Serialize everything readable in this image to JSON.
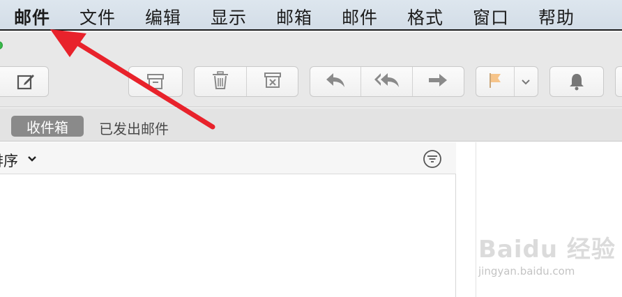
{
  "menubar": {
    "items": [
      {
        "label": "邮件",
        "active": true
      },
      {
        "label": "文件"
      },
      {
        "label": "编辑"
      },
      {
        "label": "显示"
      },
      {
        "label": "邮箱"
      },
      {
        "label": "邮件"
      },
      {
        "label": "格式"
      },
      {
        "label": "窗口"
      },
      {
        "label": "帮助"
      }
    ]
  },
  "toolbar": {
    "buttons": [
      {
        "icon": "compose-icon"
      },
      {
        "icon": "archive-icon"
      },
      {
        "icon": "trash-icon"
      },
      {
        "icon": "junk-icon"
      },
      {
        "icon": "reply-icon"
      },
      {
        "icon": "reply-all-icon"
      },
      {
        "icon": "forward-icon"
      },
      {
        "icon": "flag-icon",
        "color": "#f6c48a"
      },
      {
        "icon": "chevron-down-icon"
      },
      {
        "icon": "bell-icon"
      }
    ]
  },
  "mailboxes": {
    "active": "收件箱",
    "other": "已发出邮件"
  },
  "list": {
    "sort_label": "排序"
  },
  "annotation": {
    "arrow_color": "#e8222b"
  },
  "watermark": {
    "logo": "Baidu 经验",
    "url": "jingyan.baidu.com"
  }
}
